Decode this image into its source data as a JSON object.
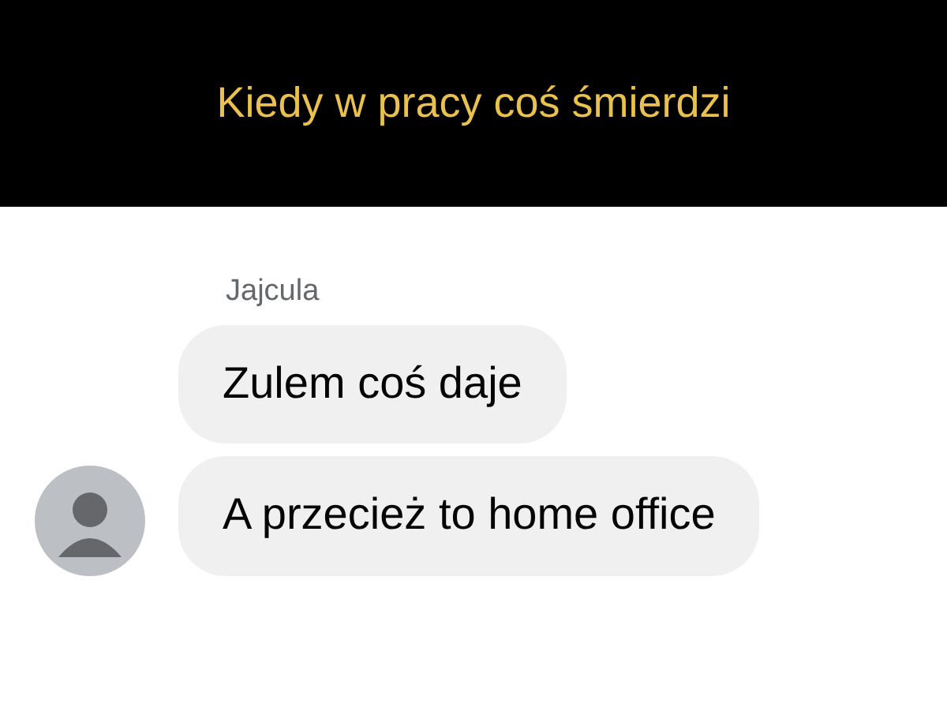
{
  "caption": "Kiedy w pracy coś śmierdzi",
  "chat": {
    "sender": "Jajcula",
    "messages": [
      {
        "text": "Zulem coś daje"
      },
      {
        "text": "A przecież to home office"
      }
    ]
  }
}
